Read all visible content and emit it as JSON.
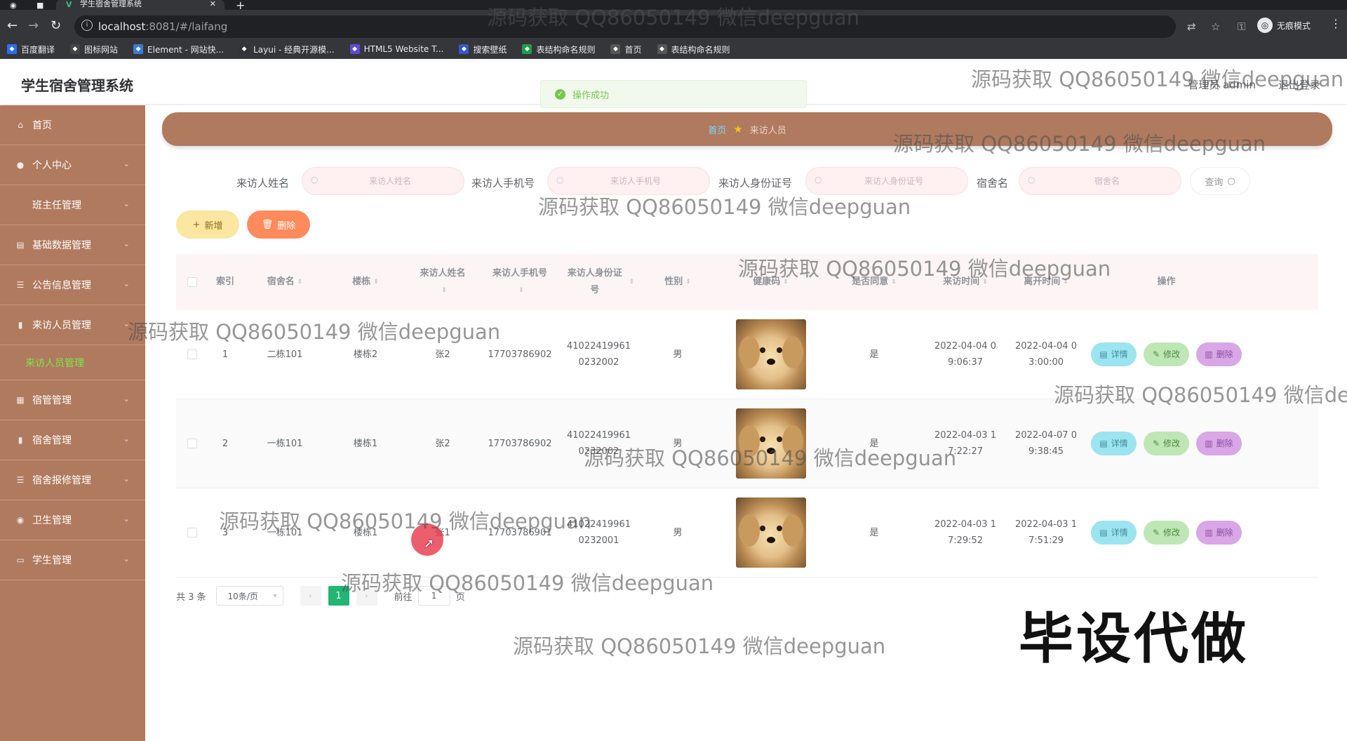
{
  "browser": {
    "tab_title": "学生宿舍管理系统",
    "url_host": "localhost",
    "url_rest": ":8081/#/laifang",
    "incognito_label": "无痕模式",
    "bookmarks": [
      {
        "label": "百度翻译",
        "color": "#2a6ef0"
      },
      {
        "label": "图标网站",
        "color": "#444444"
      },
      {
        "label": "Element - 网站快...",
        "color": "#3a7bd5"
      },
      {
        "label": "Layui - 经典开源模...",
        "color": "#333333"
      },
      {
        "label": "HTML5 Website T...",
        "color": "#5b4bd6"
      },
      {
        "label": "搜索壁纸",
        "color": "#3559c7"
      },
      {
        "label": "表结构命名规则",
        "color": "#1e9e4a"
      },
      {
        "label": "首页",
        "color": "#555555"
      },
      {
        "label": "表结构命名规则",
        "color": "#555555"
      }
    ]
  },
  "app": {
    "title": "学生宿舍管理系统",
    "user": "管理员 admin",
    "logout": "退出登录"
  },
  "toast": "操作成功",
  "sidebar": [
    {
      "label": "首页",
      "icon": "home-icon",
      "glyph": "⌂",
      "arrow": false,
      "sub": false
    },
    {
      "label": "个人中心",
      "icon": "user-icon",
      "glyph": "●",
      "arrow": true,
      "sub": false
    },
    {
      "label": "班主任管理",
      "icon": "",
      "glyph": "",
      "arrow": true,
      "sub": true
    },
    {
      "label": "基础数据管理",
      "icon": "database-icon",
      "glyph": "▤",
      "arrow": true,
      "sub": false
    },
    {
      "label": "公告信息管理",
      "icon": "list-icon",
      "glyph": "☰",
      "arrow": true,
      "sub": false
    },
    {
      "label": "来访人员管理",
      "icon": "chart-icon",
      "glyph": "▮",
      "arrow": true,
      "sub": false
    }
  ],
  "sidebar_active_sub": "来访人员管理",
  "sidebar_rest": [
    {
      "label": "宿管管理",
      "icon": "building-icon",
      "glyph": "▦",
      "arrow": true
    },
    {
      "label": "宿舍管理",
      "icon": "chart-icon",
      "glyph": "▮",
      "arrow": true
    },
    {
      "label": "宿舍报修管理",
      "icon": "list-icon",
      "glyph": "☰",
      "arrow": true
    },
    {
      "label": "卫生管理",
      "icon": "location-icon",
      "glyph": "◉",
      "arrow": true
    },
    {
      "label": "学生管理",
      "icon": "screen-icon",
      "glyph": "▭",
      "arrow": true
    }
  ],
  "breadcrumb": {
    "home": "首页",
    "current": "来访人员"
  },
  "search": {
    "fields": [
      {
        "label": "来访人姓名",
        "placeholder": "来访人姓名"
      },
      {
        "label": "来访人手机号",
        "placeholder": "来访人手机号"
      },
      {
        "label": "来访人身份证号",
        "placeholder": "来访人身份证号"
      },
      {
        "label": "宿舍名",
        "placeholder": "宿舍名"
      }
    ],
    "query_label": "查询"
  },
  "actions": {
    "add": "新增",
    "delete": "删除"
  },
  "table": {
    "headers": [
      "索引",
      "宿舍名",
      "楼栋",
      "来访人姓名",
      "来访人手机号",
      "来访人身份证号",
      "性别",
      "健康码",
      "是否同意",
      "来访时间",
      "离开时间",
      "操作"
    ],
    "rows": [
      {
        "index": "1",
        "dorm": "二栋101",
        "building": "楼栋2",
        "name": "张2",
        "phone": "17703786902",
        "idcard": "410224199610232002",
        "gender": "男",
        "agree": "是",
        "visit": "2022-04-04 09:06:37",
        "leave": "2022-04-04 03:00:00"
      },
      {
        "index": "2",
        "dorm": "一栋101",
        "building": "楼栋1",
        "name": "张2",
        "phone": "17703786902",
        "idcard": "410224199610232002",
        "gender": "男",
        "agree": "是",
        "visit": "2022-04-03 17:22:27",
        "leave": "2022-04-07 09:38:45"
      },
      {
        "index": "3",
        "dorm": "一栋101",
        "building": "楼栋1",
        "name": "张1",
        "phone": "17703786901",
        "idcard": "410224199610232001",
        "gender": "男",
        "agree": "是",
        "visit": "2022-04-03 17:29:52",
        "leave": "2022-04-03 17:51:29"
      }
    ],
    "op_detail": "详情",
    "op_edit": "修改",
    "op_delete": "删除"
  },
  "pager": {
    "total": "共 3 条",
    "size": "10条/页",
    "page": "1",
    "goto": "前往",
    "goto_value": "1",
    "page_unit": "页"
  },
  "watermark": "源码获取 QQ86050149 微信deepguan",
  "overlay_text": "毕设代做"
}
